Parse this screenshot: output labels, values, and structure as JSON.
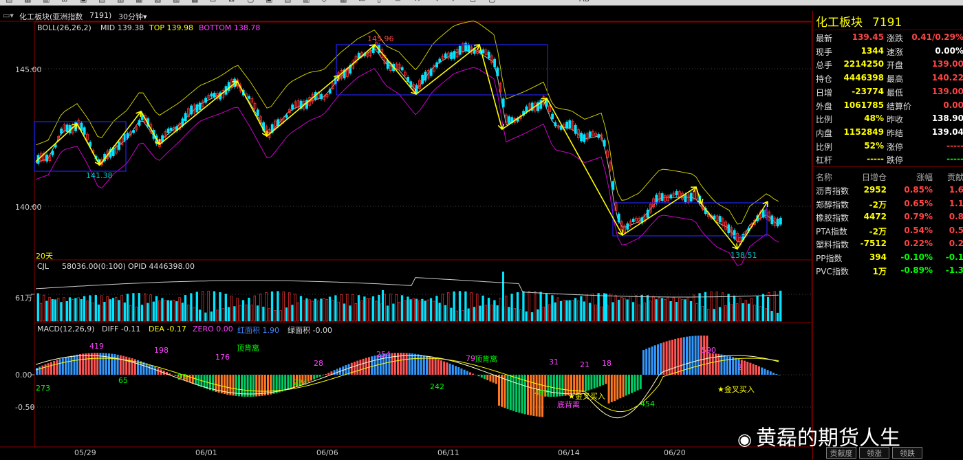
{
  "toolbar": {
    "icons": [
      "▤",
      "▦",
      "▥",
      "⊞",
      "▣",
      "▤",
      "▥",
      "▦",
      "▧",
      "▨",
      "▩",
      "⊟",
      "⊠",
      "▢",
      "▣",
      "▤",
      "▥",
      "◇",
      "▦",
      "▭",
      "▯",
      "▱",
      "✕",
      "↖",
      "↗",
      "◻",
      "▢"
    ],
    "right_items": [
      "AB"
    ]
  },
  "title": {
    "name": "化工板块(亚洲指数",
    "code": "7191)",
    "period": "30分钟"
  },
  "boll": {
    "label": "BOLL(26,26,2)",
    "mid": "MID 139.38",
    "top": "TOP 139.98",
    "bottom": "BOTTOM 138.78"
  },
  "price_axis": [
    "145.00",
    "140.00"
  ],
  "price_annotations": {
    "high": "145.96",
    "low1": "141.38",
    "low2": "138.51",
    "days": "20天"
  },
  "volume": {
    "label": "CJL",
    "value": "58036.00(0:100)",
    "opid": "OPID 4446398.00",
    "axis": "61万"
  },
  "macd": {
    "label": "MACD(12,26,9)",
    "diff": "DIFF -0.11",
    "dea": "DEA -0.17",
    "zero": "ZERO 0.00",
    "red_area": "红面积 1.90",
    "green_area": "绿面积 -0.00",
    "axis": [
      "0.00",
      "-0.50"
    ],
    "annotations": [
      {
        "text": "419",
        "color": "#ff44ff"
      },
      {
        "text": "198",
        "color": "#ff44ff"
      },
      {
        "text": "176",
        "color": "#ff44ff"
      },
      {
        "text": "28",
        "color": "#ff44ff"
      },
      {
        "text": "254",
        "color": "#ff44ff"
      },
      {
        "text": "79",
        "color": "#ff44ff"
      },
      {
        "text": "31",
        "color": "#ff44ff"
      },
      {
        "text": "21",
        "color": "#ff44ff"
      },
      {
        "text": "18",
        "color": "#ff44ff"
      },
      {
        "text": "590",
        "color": "#ff44ff"
      },
      {
        "text": "2",
        "color": "#ff44ff"
      },
      {
        "text": "273",
        "color": "#00ff00"
      },
      {
        "text": "65",
        "color": "#00ff00"
      },
      {
        "text": "25",
        "color": "#00ff00"
      },
      {
        "text": "224",
        "color": "#00ff00"
      },
      {
        "text": "242",
        "color": "#00ff00"
      },
      {
        "text": "495",
        "color": "#00ff00"
      },
      {
        "text": "454",
        "color": "#00ff00"
      },
      {
        "text": "顶背离",
        "color": "#00ff00"
      },
      {
        "text": "顶背离",
        "color": "#00ff00"
      },
      {
        "text": "★金叉买入",
        "color": "#ffff00"
      },
      {
        "text": "★金叉买入",
        "color": "#ffff00"
      },
      {
        "text": "底背离",
        "color": "#ff44ff"
      }
    ]
  },
  "dates": [
    "05/29",
    "06/01",
    "06/06",
    "06/11",
    "06/14",
    "06/20"
  ],
  "side": {
    "title": "化工板块",
    "code": "7191",
    "quotes": [
      {
        "l1": "最新",
        "v1": "139.45",
        "c1": "#ff4444",
        "l2": "涨跌",
        "v2": "0.41/0.29%",
        "c2": "#ff4444"
      },
      {
        "l1": "现手",
        "v1": "1344",
        "c1": "#ffff00",
        "l2": "速涨",
        "v2": "0.00%",
        "c2": "#ffffff"
      },
      {
        "l1": "总手",
        "v1": "2214250",
        "c1": "#ffff00",
        "l2": "开盘",
        "v2": "139.00",
        "c2": "#ff4444"
      },
      {
        "l1": "持仓",
        "v1": "4446398",
        "c1": "#ffff00",
        "l2": "最高",
        "v2": "140.22",
        "c2": "#ff4444"
      },
      {
        "l1": "日增",
        "v1": "-23774",
        "c1": "#ffff00",
        "l2": "最低",
        "v2": "139.00",
        "c2": "#ff4444"
      },
      {
        "l1": "外盘",
        "v1": "1061785",
        "c1": "#ffff00",
        "l2": "结算价",
        "v2": "0.00",
        "c2": "#ff4444"
      },
      {
        "l1": "比例",
        "v1": "48%",
        "c1": "#ffff00",
        "l2": "昨收",
        "v2": "138.90",
        "c2": "#ffffff"
      },
      {
        "l1": "内盘",
        "v1": "1152849",
        "c1": "#ffff00",
        "l2": "昨结",
        "v2": "139.04",
        "c2": "#ffffff"
      },
      {
        "l1": "比例",
        "v1": "52%",
        "c1": "#ffff00",
        "l2": "涨停",
        "v2": "-----",
        "c2": "#ff4444"
      },
      {
        "l1": "杠杆",
        "v1": "-----",
        "c1": "#ffff00",
        "l2": "跌停",
        "v2": "-----",
        "c2": "#00ff00"
      }
    ],
    "table_header": [
      "名称",
      "日增仓",
      "涨幅",
      "贡献"
    ],
    "table": [
      {
        "name": "沥青指数",
        "inc": "2952",
        "chg": "0.85%",
        "con": "1.6",
        "cc": "#ff4444"
      },
      {
        "name": "郑醇指数",
        "inc": "-2万",
        "chg": "0.65%",
        "con": "1.1",
        "cc": "#ff4444"
      },
      {
        "name": "橡胶指数",
        "inc": "4472",
        "chg": "0.79%",
        "con": "0.8",
        "cc": "#ff4444"
      },
      {
        "name": "PTA指数",
        "inc": "-2万",
        "chg": "0.54%",
        "con": "0.5",
        "cc": "#ff4444"
      },
      {
        "name": "塑料指数",
        "inc": "-7512",
        "chg": "0.22%",
        "con": "0.2",
        "cc": "#ff4444"
      },
      {
        "name": "PP指数",
        "inc": "394",
        "chg": "-0.10%",
        "con": "-0.1",
        "cc": "#00ff00"
      },
      {
        "name": "PVC指数",
        "inc": "1万",
        "chg": "-0.89%",
        "con": "-1.3",
        "cc": "#00ff00"
      }
    ]
  },
  "bottom_tabs": [
    "贡献度",
    "领涨",
    "领跌"
  ],
  "watermark": "黄磊的期货人生"
}
